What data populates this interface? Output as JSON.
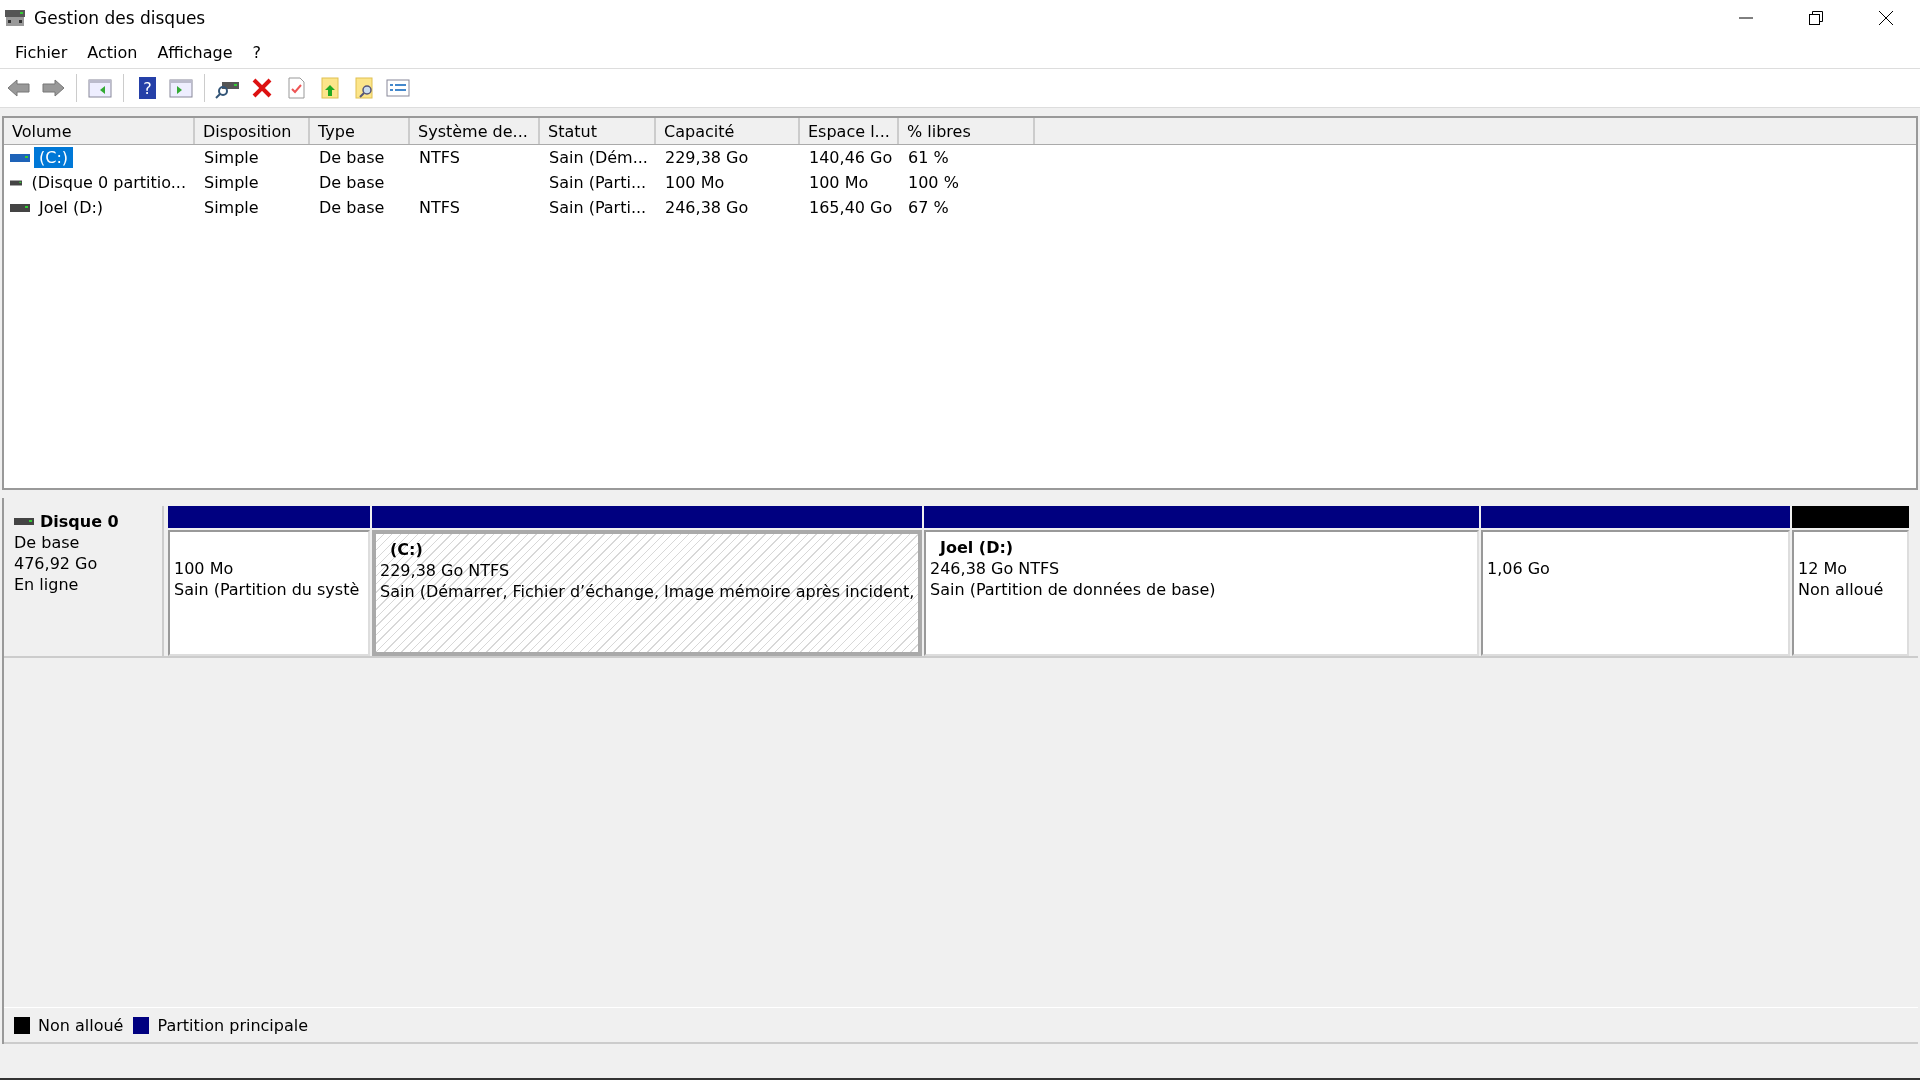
{
  "window": {
    "title": "Gestion des disques"
  },
  "menu": [
    "Fichier",
    "Action",
    "Affichage",
    "?"
  ],
  "toolbar": {
    "help_glyph": "?"
  },
  "table": {
    "columns": [
      "Volume",
      "Disposition",
      "Type",
      "Système de...",
      "Statut",
      "Capacité",
      "Espace l...",
      "% libres"
    ],
    "rows": [
      {
        "selected": true,
        "cells": [
          "(C:)",
          "Simple",
          "De base",
          "NTFS",
          "Sain (Dém...",
          "229,38 Go",
          "140,46 Go",
          "61 %"
        ]
      },
      {
        "selected": false,
        "cells": [
          "(Disque 0 partitio...",
          "Simple",
          "De base",
          "",
          "Sain (Parti...",
          "100 Mo",
          "100 Mo",
          "100 %"
        ]
      },
      {
        "selected": false,
        "cells": [
          "Joel (D:)",
          "Simple",
          "De base",
          "NTFS",
          "Sain (Parti...",
          "246,38 Go",
          "165,40 Go",
          "67 %"
        ]
      }
    ]
  },
  "disk": {
    "name": "Disque 0",
    "lines": [
      "De base",
      "476,92 Go",
      "En ligne"
    ],
    "partitions": [
      {
        "color": "#000080",
        "selected": false,
        "lines": [
          "100 Mo",
          "Sain (Partition du systè"
        ]
      },
      {
        "color": "#000080",
        "selected": true,
        "title": "(C:)",
        "lines": [
          "229,38 Go NTFS",
          "Sain (Démarrer, Fichier d’échange, Image mémoire après incident,"
        ]
      },
      {
        "color": "#000080",
        "selected": false,
        "title": "Joel  (D:)",
        "lines": [
          "246,38 Go NTFS",
          "Sain (Partition de données de base)"
        ]
      },
      {
        "color": "#000080",
        "selected": false,
        "lines": [
          "1,06 Go"
        ]
      },
      {
        "color": "#000000",
        "selected": false,
        "lines": [
          "12 Mo",
          "Non alloué"
        ]
      }
    ]
  },
  "legend": [
    {
      "color": "#000000",
      "label": "Non alloué"
    },
    {
      "color": "#000080",
      "label": "Partition principale"
    }
  ]
}
